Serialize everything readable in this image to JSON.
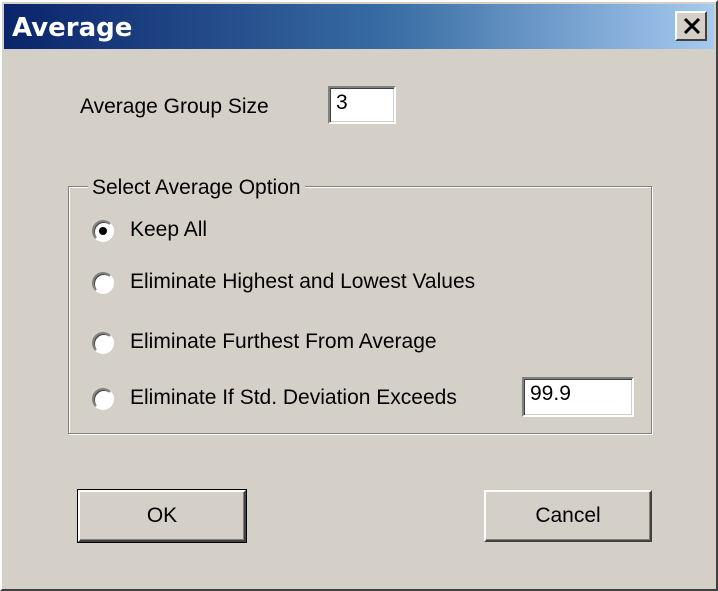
{
  "window": {
    "title": "Average",
    "close_icon": "close-icon"
  },
  "group_size": {
    "label": "Average Group Size",
    "value": "3"
  },
  "options": {
    "legend": "Select Average Option",
    "items": [
      {
        "label": "Keep All",
        "checked": true
      },
      {
        "label": "Eliminate Highest and Lowest Values",
        "checked": false
      },
      {
        "label": "Eliminate Furthest From Average",
        "checked": false
      },
      {
        "label": "Eliminate If Std. Deviation Exceeds",
        "checked": false
      }
    ],
    "std_dev_value": "99.9"
  },
  "buttons": {
    "ok": "OK",
    "cancel": "Cancel"
  },
  "colors": {
    "face": "#d4d0c8",
    "title_start": "#0a246a",
    "title_end": "#a6caf0"
  }
}
